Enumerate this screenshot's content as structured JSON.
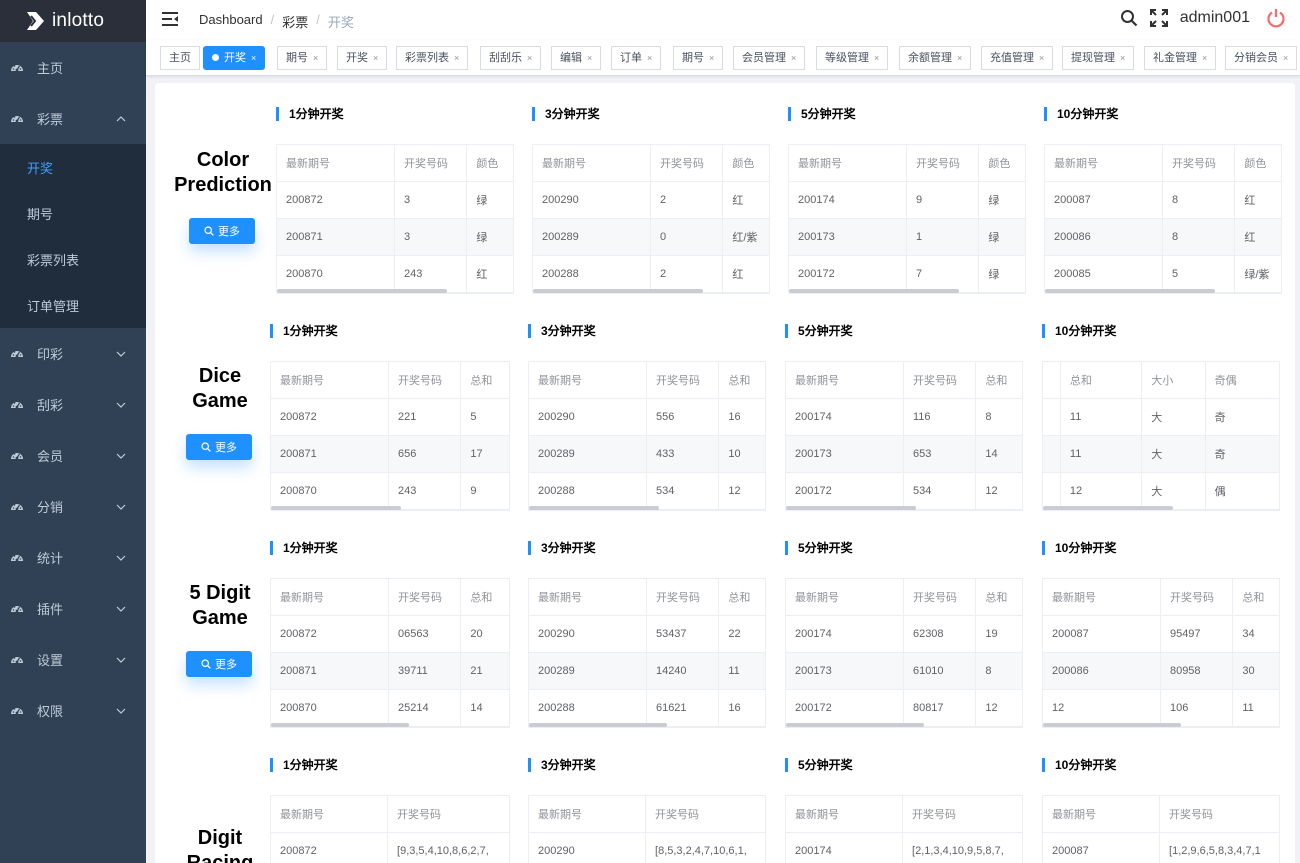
{
  "app": {
    "logo_text": "inlotto"
  },
  "sidebar": {
    "items": [
      {
        "label": "主页"
      },
      {
        "label": "彩票",
        "expanded": true,
        "children": [
          {
            "label": "开奖",
            "active": true
          },
          {
            "label": "期号"
          },
          {
            "label": "彩票列表"
          },
          {
            "label": "订单管理"
          }
        ]
      },
      {
        "label": "印彩"
      },
      {
        "label": "刮彩"
      },
      {
        "label": "会员"
      },
      {
        "label": "分销"
      },
      {
        "label": "统计"
      },
      {
        "label": "插件"
      },
      {
        "label": "设置"
      },
      {
        "label": "权限"
      }
    ]
  },
  "navbar": {
    "breadcrumb": [
      "Dashboard",
      "彩票",
      "开奖"
    ],
    "username": "admin001"
  },
  "tags": [
    {
      "label": "主页",
      "closable": false
    },
    {
      "label": "开奖",
      "active": true
    },
    {
      "label": "期号"
    },
    {
      "label": "开奖"
    },
    {
      "label": "彩票列表"
    },
    {
      "label": "刮刮乐"
    },
    {
      "label": "编辑"
    },
    {
      "label": "订单"
    },
    {
      "label": "期号"
    },
    {
      "label": "会员管理"
    },
    {
      "label": "等级管理"
    },
    {
      "label": "余额管理"
    },
    {
      "label": "充值管理"
    },
    {
      "label": "提现管理"
    },
    {
      "label": "礼金管理"
    },
    {
      "label": "分销会员"
    }
  ],
  "more_label": "更多",
  "games": [
    {
      "title": [
        "Color",
        "Prediction"
      ],
      "sections": [
        {
          "title": "1分钟开奖",
          "headers": [
            "最新期号",
            "开奖号码",
            "颜色"
          ],
          "rows": [
            [
              "200872",
              "3",
              "绿"
            ],
            [
              "200871",
              "3",
              "绿"
            ],
            [
              "200870",
              "243",
              "红"
            ]
          ]
        },
        {
          "title": "3分钟开奖",
          "headers": [
            "最新期号",
            "开奖号码",
            "颜色"
          ],
          "rows": [
            [
              "200290",
              "2",
              "红"
            ],
            [
              "200289",
              "0",
              "红/紫"
            ],
            [
              "200288",
              "2",
              "红"
            ]
          ]
        },
        {
          "title": "5分钟开奖",
          "headers": [
            "最新期号",
            "开奖号码",
            "颜色"
          ],
          "rows": [
            [
              "200174",
              "9",
              "绿"
            ],
            [
              "200173",
              "1",
              "绿"
            ],
            [
              "200172",
              "7",
              "绿"
            ]
          ]
        },
        {
          "title": "10分钟开奖",
          "headers": [
            "最新期号",
            "开奖号码",
            "颜色"
          ],
          "rows": [
            [
              "200087",
              "8",
              "红"
            ],
            [
              "200086",
              "8",
              "红"
            ],
            [
              "200085",
              "5",
              "绿/紫"
            ]
          ]
        }
      ]
    },
    {
      "title": [
        "Dice",
        "Game"
      ],
      "sections": [
        {
          "title": "1分钟开奖",
          "headers": [
            "最新期号",
            "开奖号码",
            "总和"
          ],
          "rows": [
            [
              "200872",
              "221",
              "5"
            ],
            [
              "200871",
              "656",
              "17"
            ],
            [
              "200870",
              "243",
              "9"
            ]
          ]
        },
        {
          "title": "3分钟开奖",
          "headers": [
            "最新期号",
            "开奖号码",
            "总和"
          ],
          "rows": [
            [
              "200290",
              "556",
              "16"
            ],
            [
              "200289",
              "433",
              "10"
            ],
            [
              "200288",
              "534",
              "12"
            ]
          ]
        },
        {
          "title": "5分钟开奖",
          "headers": [
            "最新期号",
            "开奖号码",
            "总和"
          ],
          "rows": [
            [
              "200174",
              "116",
              "8"
            ],
            [
              "200173",
              "653",
              "14"
            ],
            [
              "200172",
              "534",
              "12"
            ]
          ]
        },
        {
          "title": "10分钟开奖",
          "headers": [
            "",
            "总和",
            "大小",
            "奇偶"
          ],
          "rows": [
            [
              "",
              "11",
              "大",
              "奇"
            ],
            [
              "",
              "11",
              "大",
              "奇"
            ],
            [
              "",
              "12",
              "大",
              "偶"
            ]
          ]
        }
      ]
    },
    {
      "title": [
        "5 Digit",
        "Game"
      ],
      "sections": [
        {
          "title": "1分钟开奖",
          "headers": [
            "最新期号",
            "开奖号码",
            "总和"
          ],
          "rows": [
            [
              "200872",
              "06563",
              "20"
            ],
            [
              "200871",
              "39711",
              "21"
            ],
            [
              "200870",
              "25214",
              "14"
            ]
          ]
        },
        {
          "title": "3分钟开奖",
          "headers": [
            "最新期号",
            "开奖号码",
            "总和"
          ],
          "rows": [
            [
              "200290",
              "53437",
              "22"
            ],
            [
              "200289",
              "14240",
              "11"
            ],
            [
              "200288",
              "61621",
              "16"
            ]
          ]
        },
        {
          "title": "5分钟开奖",
          "headers": [
            "最新期号",
            "开奖号码",
            "总和"
          ],
          "rows": [
            [
              "200174",
              "62308",
              "19"
            ],
            [
              "200173",
              "61010",
              "8"
            ],
            [
              "200172",
              "80817",
              "12"
            ]
          ]
        },
        {
          "title": "10分钟开奖",
          "headers": [
            "最新期号",
            "开奖号码",
            "总和"
          ],
          "rows": [
            [
              "200087",
              "95497",
              "34"
            ],
            [
              "200086",
              "80958",
              "30"
            ],
            [
              "12",
              "106",
              "11"
            ]
          ]
        }
      ]
    },
    {
      "title": [
        "Digit",
        "Racing"
      ],
      "sections": [
        {
          "title": "1分钟开奖",
          "headers": [
            "最新期号",
            "开奖号码"
          ],
          "rows": [
            [
              "200872",
              "[9,3,5,4,10,8,6,2,7,"
            ]
          ]
        },
        {
          "title": "3分钟开奖",
          "headers": [
            "最新期号",
            "开奖号码"
          ],
          "rows": [
            [
              "200290",
              "[8,5,3,2,4,7,10,6,1,"
            ]
          ]
        },
        {
          "title": "5分钟开奖",
          "headers": [
            "最新期号",
            "开奖号码"
          ],
          "rows": [
            [
              "200174",
              "[2,1,3,4,10,9,5,8,7,"
            ]
          ]
        },
        {
          "title": "10分钟开奖",
          "headers": [
            "最新期号",
            "开奖号码"
          ],
          "rows": [
            [
              "200087",
              "[1,2,9,6,5,8,3,4,7,1"
            ]
          ]
        }
      ]
    }
  ]
}
